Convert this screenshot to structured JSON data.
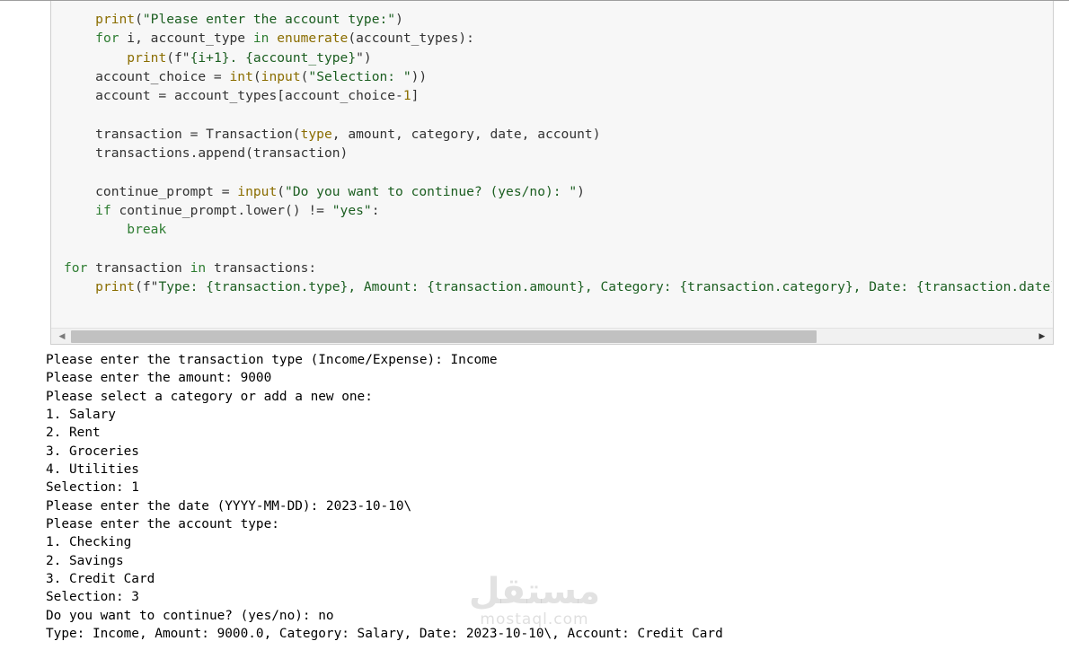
{
  "code_cell": {
    "lines": [
      [
        {
          "t": "    "
        },
        {
          "t": "print",
          "c": "bi"
        },
        {
          "t": "("
        },
        {
          "t": "\"Please enter the account type:\"",
          "c": "str"
        },
        {
          "t": ")"
        }
      ],
      [
        {
          "t": "    "
        },
        {
          "t": "for",
          "c": "kw"
        },
        {
          "t": " i, account_type "
        },
        {
          "t": "in",
          "c": "kw"
        },
        {
          "t": " "
        },
        {
          "t": "enumerate",
          "c": "bi"
        },
        {
          "t": "(account_types):"
        }
      ],
      [
        {
          "t": "        "
        },
        {
          "t": "print",
          "c": "bi"
        },
        {
          "t": "(f\""
        },
        {
          "t": "{i+1}. {account_type}",
          "c": "str"
        },
        {
          "t": "\")"
        }
      ],
      [
        {
          "t": "    account_choice = "
        },
        {
          "t": "int",
          "c": "bi"
        },
        {
          "t": "("
        },
        {
          "t": "input",
          "c": "bi"
        },
        {
          "t": "("
        },
        {
          "t": "\"Selection: \"",
          "c": "str"
        },
        {
          "t": "))"
        }
      ],
      [
        {
          "t": "    account = account_types[account_choice-"
        },
        {
          "t": "1",
          "c": "num"
        },
        {
          "t": "]"
        }
      ],
      [
        {
          "t": ""
        }
      ],
      [
        {
          "t": "    transaction = Transaction("
        },
        {
          "t": "type",
          "c": "bi"
        },
        {
          "t": ", amount, category, date, account)"
        }
      ],
      [
        {
          "t": "    transactions.append(transaction)"
        }
      ],
      [
        {
          "t": ""
        }
      ],
      [
        {
          "t": "    continue_prompt = "
        },
        {
          "t": "input",
          "c": "bi"
        },
        {
          "t": "("
        },
        {
          "t": "\"Do you want to continue? (yes/no): \"",
          "c": "str"
        },
        {
          "t": ")"
        }
      ],
      [
        {
          "t": "    "
        },
        {
          "t": "if",
          "c": "kw"
        },
        {
          "t": " continue_prompt.lower() != "
        },
        {
          "t": "\"yes\"",
          "c": "str"
        },
        {
          "t": ":"
        }
      ],
      [
        {
          "t": "        "
        },
        {
          "t": "break",
          "c": "kw"
        }
      ],
      [
        {
          "t": ""
        }
      ],
      [
        {
          "t": "for",
          "c": "kw"
        },
        {
          "t": " transaction "
        },
        {
          "t": "in",
          "c": "kw"
        },
        {
          "t": " transactions:"
        }
      ],
      [
        {
          "t": "    "
        },
        {
          "t": "print",
          "c": "bi"
        },
        {
          "t": "(f\""
        },
        {
          "t": "Type: {transaction.type}, Amount: {transaction.amount}, Category: {transaction.category}, Date: {transaction.date}",
          "c": "str"
        }
      ]
    ]
  },
  "scrollbar": {
    "left_arrow": "◀",
    "right_arrow": "▶"
  },
  "output": {
    "lines": [
      "Please enter the transaction type (Income/Expense): Income",
      "Please enter the amount: 9000",
      "Please select a category or add a new one:",
      "1. Salary",
      "2. Rent",
      "3. Groceries",
      "4. Utilities",
      "Selection: 1",
      "Please enter the date (YYYY-MM-DD): 2023-10-10\\",
      "Please enter the account type:",
      "1. Checking",
      "2. Savings",
      "3. Credit Card",
      "Selection: 3",
      "Do you want to continue? (yes/no): no",
      "Type: Income, Amount: 9000.0, Category: Salary, Date: 2023-10-10\\, Account: Credit Card"
    ]
  },
  "watermark": {
    "arabic": "مستقل",
    "latin": "mostaql.com"
  },
  "colors": {
    "keyword": "#2e7d32",
    "builtin": "#8a6d00",
    "string": "#1b5e20",
    "cell_background": "#f7f7f7"
  }
}
